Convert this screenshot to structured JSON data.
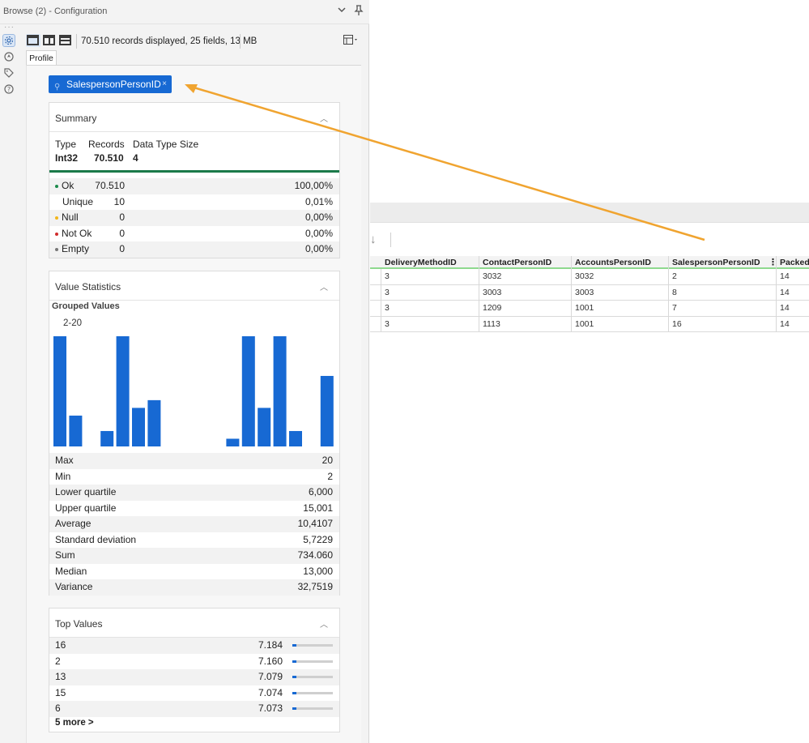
{
  "window": {
    "title": "Browse (2) - Configuration"
  },
  "toolbar": {
    "records_text": "70.510 records displayed, 25 fields, 13 MB"
  },
  "tabs": [
    {
      "label": "Profile"
    }
  ],
  "field_chip": {
    "label": "SalespersonPersonID",
    "close_glyph": "×"
  },
  "summary": {
    "heading": "Summary",
    "type_label": "Type",
    "type_value": "Int32",
    "records_label": "Records",
    "records_value": "70.510",
    "dts_label": "Data Type Size",
    "dts_value": "4",
    "rows": [
      {
        "label": "Ok",
        "count": "70.510",
        "pct": "100,00%",
        "dot": "#1b8a4b"
      },
      {
        "label": "Unique",
        "count": "10",
        "pct": "0,01%",
        "dot": ""
      },
      {
        "label": "Null",
        "count": "0",
        "pct": "0,00%",
        "dot": "#f2b619"
      },
      {
        "label": "Not Ok",
        "count": "0",
        "pct": "0,00%",
        "dot": "#d12b2b"
      },
      {
        "label": "Empty",
        "count": "0",
        "pct": "0,00%",
        "dot": "#777777"
      }
    ]
  },
  "value_stats": {
    "heading": "Value Statistics",
    "grouped_label": "Grouped Values",
    "range_label": "2-20",
    "rows": [
      {
        "label": "Max",
        "value": "20"
      },
      {
        "label": "Min",
        "value": "2"
      },
      {
        "label": "Lower quartile",
        "value": "6,000"
      },
      {
        "label": "Upper quartile",
        "value": "15,001"
      },
      {
        "label": "Average",
        "value": "10,4107"
      },
      {
        "label": "Standard deviation",
        "value": "5,7229"
      },
      {
        "label": "Sum",
        "value": "734.060"
      },
      {
        "label": "Median",
        "value": "13,000"
      },
      {
        "label": "Variance",
        "value": "32,7519"
      }
    ]
  },
  "chart_data": {
    "type": "bar",
    "title": "Grouped Values",
    "range": "2-20",
    "values": [
      1,
      0.28,
      0,
      0.14,
      1,
      0.35,
      0.42,
      0,
      0,
      0,
      0,
      0.07,
      1,
      0.35,
      1,
      0.14,
      0,
      0.64
    ],
    "color": "#1769d3"
  },
  "top_values": {
    "heading": "Top Values",
    "rows": [
      {
        "value": "16",
        "count": "7.184",
        "fraction": 0.1
      },
      {
        "value": "2",
        "count": "7.160",
        "fraction": 0.1
      },
      {
        "value": "13",
        "count": "7.079",
        "fraction": 0.1
      },
      {
        "value": "15",
        "count": "7.074",
        "fraction": 0.1
      },
      {
        "value": "6",
        "count": "7.073",
        "fraction": 0.1
      }
    ],
    "more_label": "5 more >"
  },
  "grid": {
    "columns": [
      "DeliveryMethodID",
      "ContactPersonID",
      "AccountsPersonID",
      "SalespersonPersonID",
      "PackedB"
    ],
    "rows": [
      [
        "3",
        "3032",
        "3032",
        "2",
        "14"
      ],
      [
        "3",
        "3003",
        "3003",
        "8",
        "14"
      ],
      [
        "3",
        "1209",
        "1001",
        "7",
        "14"
      ],
      [
        "3",
        "1113",
        "1001",
        "16",
        "14"
      ]
    ]
  },
  "colors": {
    "accent": "#1769d3",
    "ok_green": "#1b8a4b",
    "arrow": "#f0a430"
  }
}
